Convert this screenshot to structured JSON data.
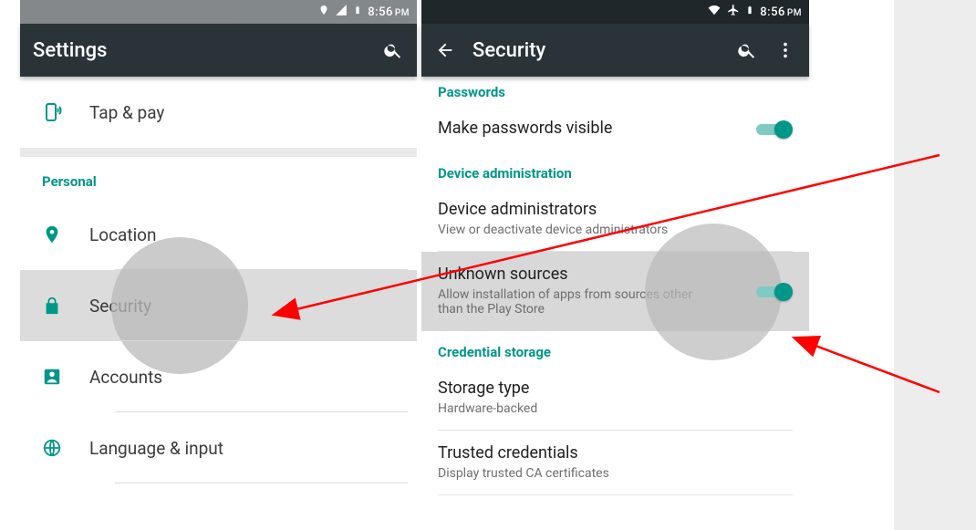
{
  "left": {
    "status_time": "8:56",
    "status_ampm": "PM",
    "appbar_title": "Settings",
    "row_tap_pay": "Tap & pay",
    "section_personal": "Personal",
    "row_location": "Location",
    "row_security": "Security",
    "row_accounts": "Accounts",
    "row_language": "Language & input"
  },
  "right": {
    "status_time": "8:56",
    "status_ampm": "PM",
    "appbar_title": "Security",
    "section_passwords": "Passwords",
    "item_pw_visible": "Make passwords visible",
    "section_device_admin": "Device administration",
    "item_dev_admin_title": "Device administrators",
    "item_dev_admin_sub": "View or deactivate device administrators",
    "item_unknown_title": "Unknown sources",
    "item_unknown_sub": "Allow installation of apps from sources other than the Play Store",
    "section_cred": "Credential storage",
    "item_storage_title": "Storage type",
    "item_storage_sub": "Hardware-backed",
    "item_trusted_title": "Trusted credentials",
    "item_trusted_sub": "Display trusted CA certificates"
  }
}
